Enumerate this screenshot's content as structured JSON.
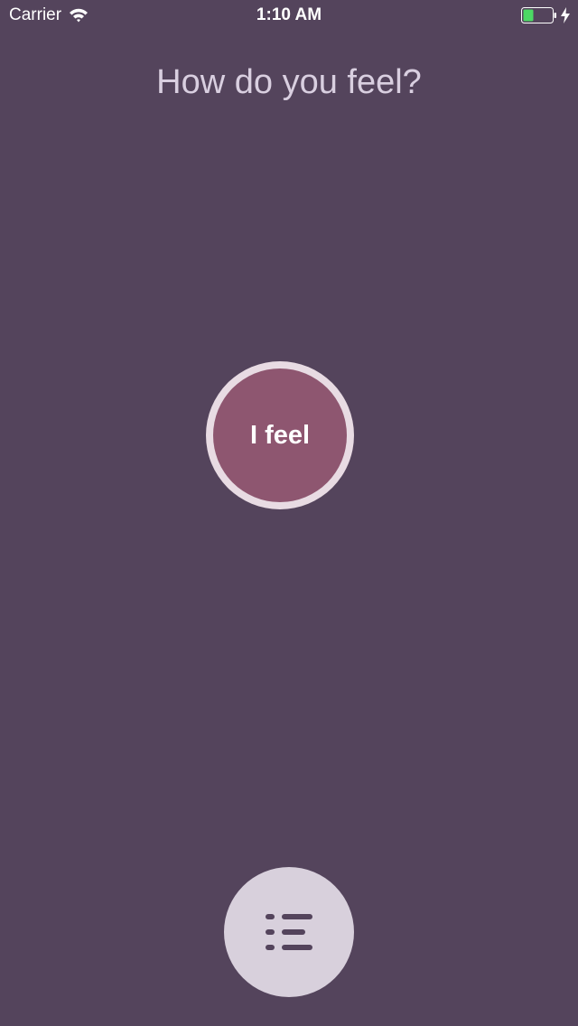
{
  "status_bar": {
    "carrier": "Carrier",
    "time": "1:10 AM",
    "wifi_icon": "wifi-icon",
    "battery_icon": "battery-icon",
    "charging_icon": "bolt-icon"
  },
  "main": {
    "title": "How do you feel?",
    "feel_button_label": "I feel",
    "list_button_icon": "list-icon"
  },
  "colors": {
    "background": "#54445c",
    "title_text": "#d9cfe0",
    "feel_button_fill": "#8e5670",
    "feel_button_ring": "#e8dbe3",
    "list_button_fill": "#d8d0dc",
    "list_icon": "#54445c",
    "battery_level": "#4cd964"
  }
}
